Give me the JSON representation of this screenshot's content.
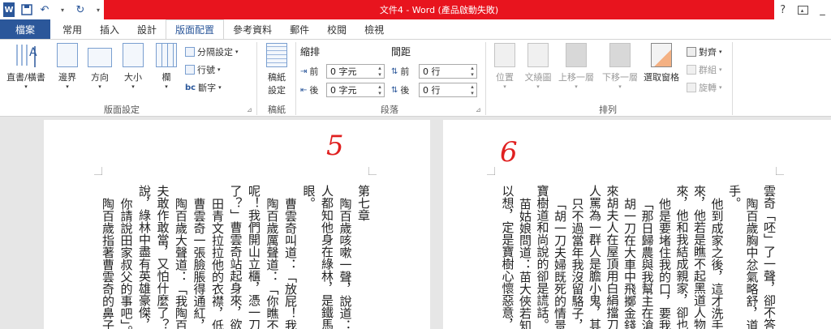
{
  "window": {
    "title": "文件4 - Word (產品啟動失敗)",
    "help": "?"
  },
  "tabs": [
    {
      "label": "檔案"
    },
    {
      "label": "常用"
    },
    {
      "label": "插入"
    },
    {
      "label": "設計"
    },
    {
      "label": "版面配置"
    },
    {
      "label": "參考資料"
    },
    {
      "label": "郵件"
    },
    {
      "label": "校閱"
    },
    {
      "label": "檢視"
    }
  ],
  "ribbon": {
    "page_setup": {
      "label": "版面設定",
      "text_direction": "直書/橫書",
      "margins": "邊界",
      "orientation": "方向",
      "size": "大小",
      "columns": "欄",
      "breaks": "分隔設定",
      "line_numbers": "行號",
      "hyphenation": "斷字"
    },
    "manuscript": {
      "label": "稿紙",
      "settings_line1": "稿紙",
      "settings_line2": "設定"
    },
    "paragraph": {
      "label": "段落",
      "indent_title": "縮排",
      "spacing_title": "間距",
      "indent_before_label": "前",
      "indent_after_label": "後",
      "indent_before_value": "0 字元",
      "indent_after_value": "0 字元",
      "spacing_before_label": "前",
      "spacing_after_label": "後",
      "spacing_before_value": "0 行",
      "spacing_after_value": "0 行"
    },
    "arrange": {
      "label": "排列",
      "position": "位置",
      "wrap_text": "文繞圖",
      "bring_forward": "上移一層",
      "send_backward": "下移一層",
      "selection_pane": "選取窗格",
      "align": "對齊",
      "group": "群組",
      "rotate": "旋轉"
    }
  },
  "document": {
    "left_page_number": "5",
    "right_page_number": "6",
    "left_columns": [
      "第七章",
      "陶百歲咳嗽一聲，說道：「",
      "人都知他身在綠林，是鐵馬川",
      "眼。",
      "曹雲奇叫道：「放屁！我師",
      "陶百歲厲聲道：「你瞧不起",
      "呢！我們開山立櫃，憑一刀一",
      "了？」曹雲奇站起身來，欲待",
      "田青文拉拉他的衣襟，低",
      "曹雲奇一張臉脹得通紅，",
      "陶百歲大聲道：「我陶百",
      "夫敢作敢當，又怕什麼了？」",
      "說，綠林中盡有英雄豪傑，誰",
      "你請說田家叔父的事吧」。",
      "陶百歲指著曹雲奇的鼻子道"
    ],
    "right_columns": [
      "雲奇「呸」了一聲，卻不答話",
      "陶百歲胸中忿氣略舒，道",
      "手。",
      "他到成家之後，這才洗手",
      "來，他若是瞧不起黑道人物，",
      "來，他和我結成親家，卻也不",
      "他是要堵住我的口，要我",
      "「那日歸農與我幫主在滄",
      "胡一刀在大車中飛擲金錢",
      "來胡夫人在屋頂用白絹擋刀擲",
      "人罵為一群人是膽小鬼，其中",
      "只不過當年我沒留駱子，",
      "「胡一刀夫婦既死的情景",
      "寶樹道和尚說的卻是謊話。",
      "苗姑娘問道：苗大俠若知",
      "以想，定是寶樹心懷惡意，沒"
    ]
  }
}
